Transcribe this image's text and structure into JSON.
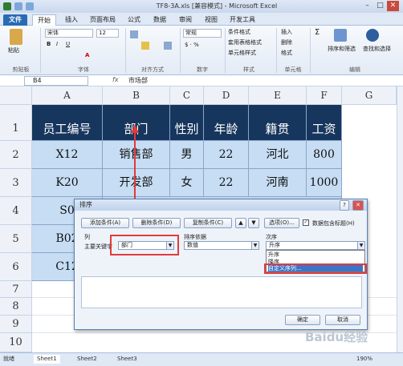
{
  "window": {
    "title": "TF8-3A.xls [兼容模式] - Microsoft Excel",
    "min": "–",
    "max": "□",
    "close": "✕"
  },
  "tabs": [
    "文件",
    "开始",
    "插入",
    "页面布局",
    "公式",
    "数据",
    "审阅",
    "视图",
    "开发工具"
  ],
  "ribbon": {
    "paste": "粘贴",
    "font_name": "宋体",
    "font_size": "12",
    "number_format": "常规",
    "cond_format": "条件格式",
    "table_format": "套用表格格式",
    "cell_style": "单元格样式",
    "insert": "插入",
    "delete": "删除",
    "format": "格式",
    "sort_filter": "排序和筛选",
    "find_select": "查找和选择",
    "groups": [
      "剪贴板",
      "字体",
      "对齐方式",
      "数字",
      "样式",
      "单元格",
      "编辑"
    ]
  },
  "formula_bar": {
    "name_box": "B4",
    "fx": "fx",
    "value": "市场部"
  },
  "columns": [
    "A",
    "B",
    "C",
    "D",
    "E",
    "F",
    "G"
  ],
  "rows": [
    "1",
    "2",
    "3",
    "4",
    "5",
    "6",
    "7",
    "8",
    "9",
    "10"
  ],
  "table": {
    "headers": [
      "员工编号",
      "部门",
      "性别",
      "年龄",
      "籍贯",
      "工资"
    ],
    "rows": [
      [
        "X12",
        "销售部",
        "男",
        "22",
        "河北",
        "800"
      ],
      [
        "K20",
        "开发部",
        "女",
        "22",
        "河南",
        "1000"
      ],
      [
        "S0",
        "",
        "",
        "",
        "",
        ""
      ],
      [
        "B02",
        "",
        "",
        "",
        "",
        ""
      ],
      [
        "C12",
        "",
        "",
        "",
        "",
        ""
      ]
    ]
  },
  "dialog": {
    "title": "排序",
    "add_level": "添加条件(A)",
    "delete_level": "删除条件(D)",
    "copy_level": "复制条件(C)",
    "options": "选项(O)...",
    "has_headers": "数据包含标题(H)",
    "col_header": "列",
    "sort_on_header": "排序依据",
    "order_header": "次序",
    "main_key_label": "主要关键字",
    "main_key_value": "部门",
    "sort_on_value": "数值",
    "order_value": "升序",
    "order_options": [
      "升序",
      "降序",
      "自定义序列..."
    ],
    "ok": "确定",
    "cancel": "取消",
    "close": "✕",
    "help": "?"
  },
  "sheets": [
    "Sheet1",
    "Sheet2",
    "Sheet3"
  ],
  "status": {
    "ready": "就绪",
    "zoom": "190%"
  },
  "watermark": "Baidu经验",
  "colors": {
    "header_bg": "#17365d",
    "data_bg": "#c6ddf4",
    "highlight": "#e23b3b"
  }
}
